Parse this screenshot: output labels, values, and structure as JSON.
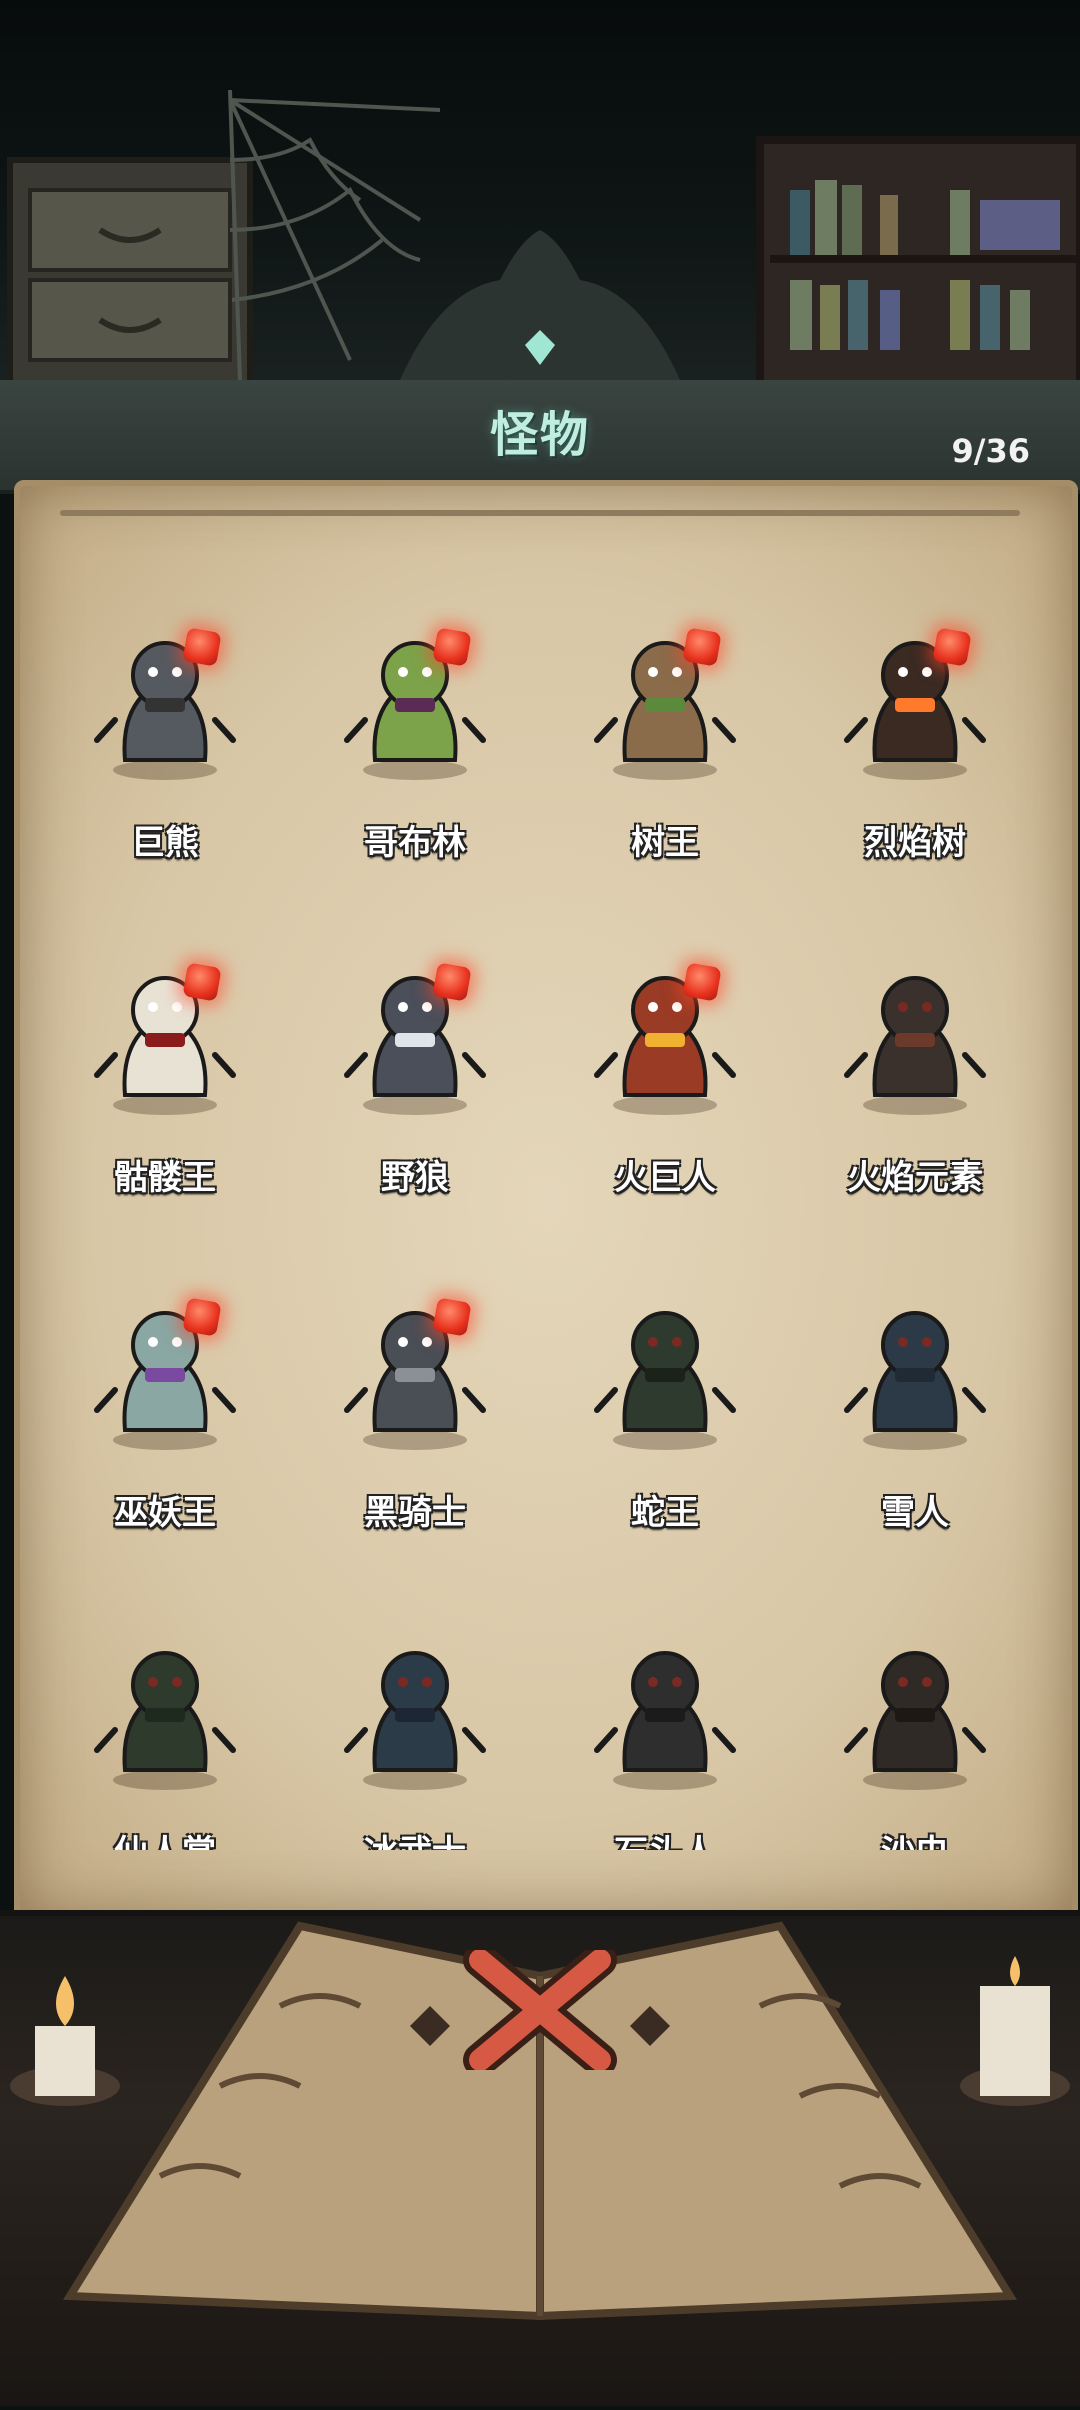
{
  "header": {
    "title": "怪物",
    "counter": "9/36"
  },
  "colors": {
    "title_glow": "#bfeee0",
    "badge": "#e8321e",
    "parchment": "#d8c7a6"
  },
  "monsters": [
    {
      "name": "巨熊",
      "icon": "bear-icon",
      "discovered": true,
      "new": true
    },
    {
      "name": "哥布林",
      "icon": "goblin-icon",
      "discovered": true,
      "new": true
    },
    {
      "name": "树王",
      "icon": "treant-icon",
      "discovered": true,
      "new": true
    },
    {
      "name": "烈焰树",
      "icon": "flame-tree-icon",
      "discovered": true,
      "new": true
    },
    {
      "name": "骷髅王",
      "icon": "skeleton-king-icon",
      "discovered": true,
      "new": true
    },
    {
      "name": "野狼",
      "icon": "wolf-icon",
      "discovered": true,
      "new": true
    },
    {
      "name": "火巨人",
      "icon": "fire-giant-icon",
      "discovered": true,
      "new": true
    },
    {
      "name": "火焰元素",
      "icon": "fire-elemental-icon",
      "discovered": false,
      "new": false
    },
    {
      "name": "巫妖王",
      "icon": "lich-king-icon",
      "discovered": true,
      "new": true
    },
    {
      "name": "黑骑士",
      "icon": "black-knight-icon",
      "discovered": true,
      "new": true
    },
    {
      "name": "蛇王",
      "icon": "snake-king-icon",
      "discovered": false,
      "new": false
    },
    {
      "name": "雪人",
      "icon": "yeti-icon",
      "discovered": false,
      "new": false
    },
    {
      "name": "仙人掌",
      "icon": "cactus-icon",
      "discovered": false,
      "new": false
    },
    {
      "name": "冰武士",
      "icon": "ice-warrior-icon",
      "discovered": false,
      "new": false
    },
    {
      "name": "石头人",
      "icon": "stone-golem-icon",
      "discovered": false,
      "new": false
    },
    {
      "name": "沙虫",
      "icon": "sandworm-icon",
      "discovered": false,
      "new": false
    }
  ],
  "close": {
    "icon": "close-x-icon"
  }
}
